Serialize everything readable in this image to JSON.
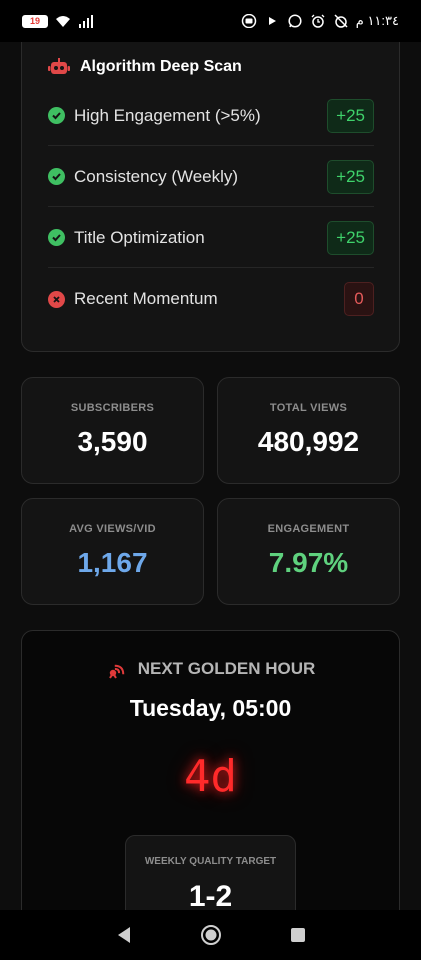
{
  "status_bar": {
    "battery": "19",
    "time": "١١:٣٤ م"
  },
  "scan": {
    "title": "Algorithm Deep Scan",
    "icon": "robot-icon",
    "rows": [
      {
        "label": "High Engagement (>5%)",
        "badge": "+25",
        "passed": true
      },
      {
        "label": "Consistency (Weekly)",
        "badge": "+25",
        "passed": true
      },
      {
        "label": "Title Optimization",
        "badge": "+25",
        "passed": true
      },
      {
        "label": "Recent Momentum",
        "badge": "0",
        "passed": false
      }
    ]
  },
  "stats": {
    "subscribers": {
      "label": "SUBSCRIBERS",
      "value": "3,590",
      "color": "#ffffff"
    },
    "total_views": {
      "label": "TOTAL VIEWS",
      "value": "480,992",
      "color": "#ffffff"
    },
    "avg_views": {
      "label": "AVG VIEWS/VID",
      "value": "1,167",
      "color": "#6ea8ea"
    },
    "engagement": {
      "label": "ENGAGEMENT",
      "value": "7.97%",
      "color": "#5fd17e"
    }
  },
  "golden_hour": {
    "heading": "NEXT GOLDEN HOUR",
    "icon": "broadcast-icon",
    "time": "Tuesday, 05:00",
    "countdown": "4d",
    "target": {
      "label": "WEEKLY QUALITY TARGET",
      "value": "1-2"
    }
  },
  "colors": {
    "accent_green": "#3fd26b",
    "accent_red": "#e53935",
    "background": "#0d0d0d"
  }
}
